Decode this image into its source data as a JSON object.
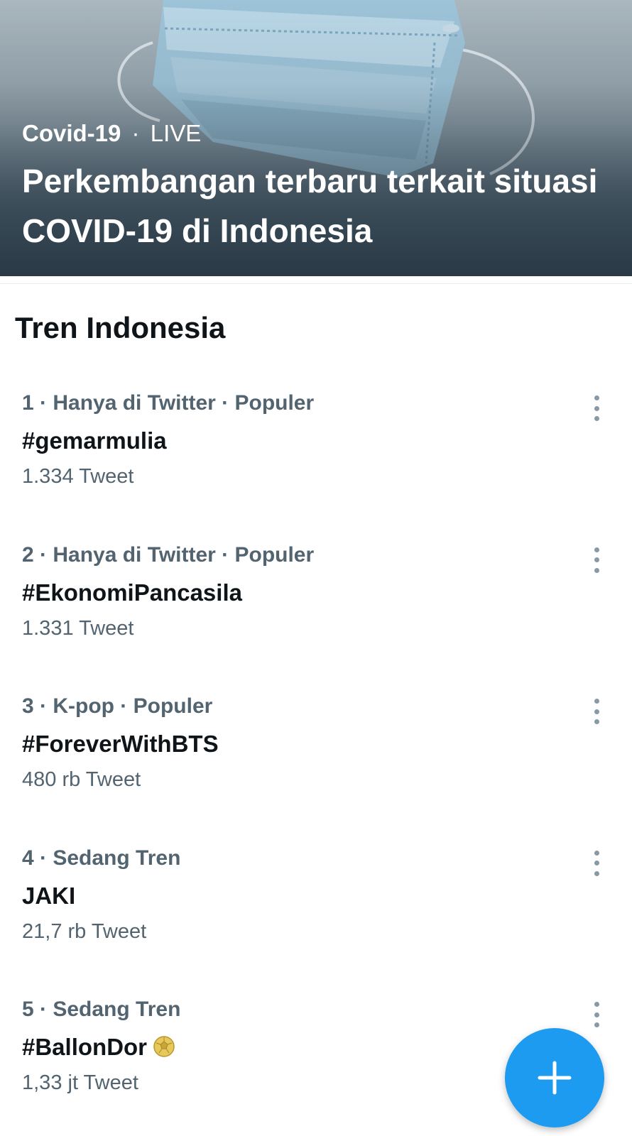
{
  "hero": {
    "topic": "Covid-19",
    "separator": "·",
    "status": "LIVE",
    "title": "Perkembangan terbaru terkait situasi COVID-19 di Indonesia",
    "image_icon": "face-mask-photo"
  },
  "section": {
    "title": "Tren Indonesia"
  },
  "trends": [
    {
      "context": "1 · Hanya di Twitter · Populer",
      "name": "#gemarmulia",
      "count": "1.334 Tweet"
    },
    {
      "context": "2 · Hanya di Twitter · Populer",
      "name": "#EkonomiPancasila",
      "count": "1.331 Tweet"
    },
    {
      "context": "3 · K-pop · Populer",
      "name": "#ForeverWithBTS",
      "count": "480 rb Tweet"
    },
    {
      "context": "4 · Sedang Tren",
      "name": "JAKI",
      "count": "21,7 rb Tweet"
    },
    {
      "context": "5 · Sedang Tren",
      "name": "#BallonDor",
      "count": "1,33 jt Tweet",
      "icon": "golden-ball-icon"
    }
  ],
  "fab": {
    "icon": "plus-icon",
    "color": "#1d9bf0"
  },
  "colors": {
    "primary_text": "#0f1419",
    "secondary_text": "#536471",
    "accent": "#1d9bf0"
  }
}
